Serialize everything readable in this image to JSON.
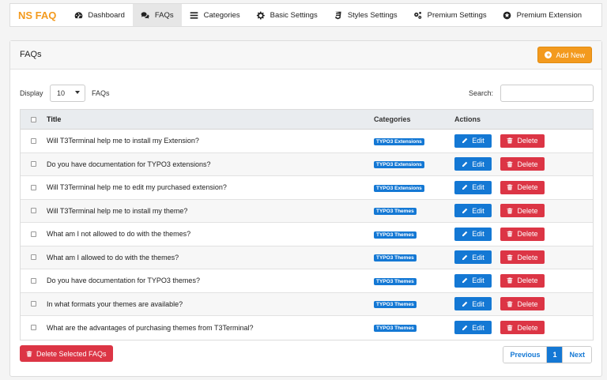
{
  "brand": "NS FAQ",
  "nav": [
    {
      "label": "Dashboard",
      "icon": "dashboard-icon"
    },
    {
      "label": "FAQs",
      "icon": "comments-icon",
      "active": true
    },
    {
      "label": "Categories",
      "icon": "list-icon"
    },
    {
      "label": "Basic Settings",
      "icon": "gear-icon"
    },
    {
      "label": "Styles Settings",
      "icon": "css3-icon"
    },
    {
      "label": "Premium Settings",
      "icon": "gears-icon"
    },
    {
      "label": "Premium Extension",
      "icon": "star-circle-icon"
    }
  ],
  "panel": {
    "title": "FAQs",
    "add_label": "Add New"
  },
  "controls": {
    "display_label": "Display",
    "display_value": "10",
    "faqs_label": "FAQs",
    "search_label": "Search:",
    "search_value": ""
  },
  "table": {
    "headers": {
      "title": "Title",
      "categories": "Categories",
      "actions": "Actions"
    },
    "edit_label": "Edit",
    "delete_label": "Delete",
    "rows": [
      {
        "title": "Will T3Terminal help me to install my Extension?",
        "category": "TYPO3 Extensions"
      },
      {
        "title": "Do you have documentation for TYPO3 extensions?",
        "category": "TYPO3 Extensions"
      },
      {
        "title": "Will T3Terminal help me to edit my purchased extension?",
        "category": "TYPO3 Extensions"
      },
      {
        "title": "Will T3Terminal help me to install my theme?",
        "category": "TYPO3 Themes"
      },
      {
        "title": "What am I not allowed to do with the themes?",
        "category": "TYPO3 Themes"
      },
      {
        "title": "What am I allowed to do with the themes?",
        "category": "TYPO3 Themes"
      },
      {
        "title": "Do you have documentation for TYPO3 themes?",
        "category": "TYPO3 Themes"
      },
      {
        "title": "In what formats your themes are available?",
        "category": "TYPO3 Themes"
      },
      {
        "title": "What are the advantages of purchasing themes from T3Terminal?",
        "category": "TYPO3 Themes"
      }
    ]
  },
  "footer": {
    "delete_selected_label": "Delete Selected FAQs",
    "pagination": {
      "previous": "Previous",
      "current": "1",
      "next": "Next"
    }
  },
  "colors": {
    "brand": "#f39a1e",
    "primary": "#1478d4",
    "danger": "#dc3545"
  }
}
